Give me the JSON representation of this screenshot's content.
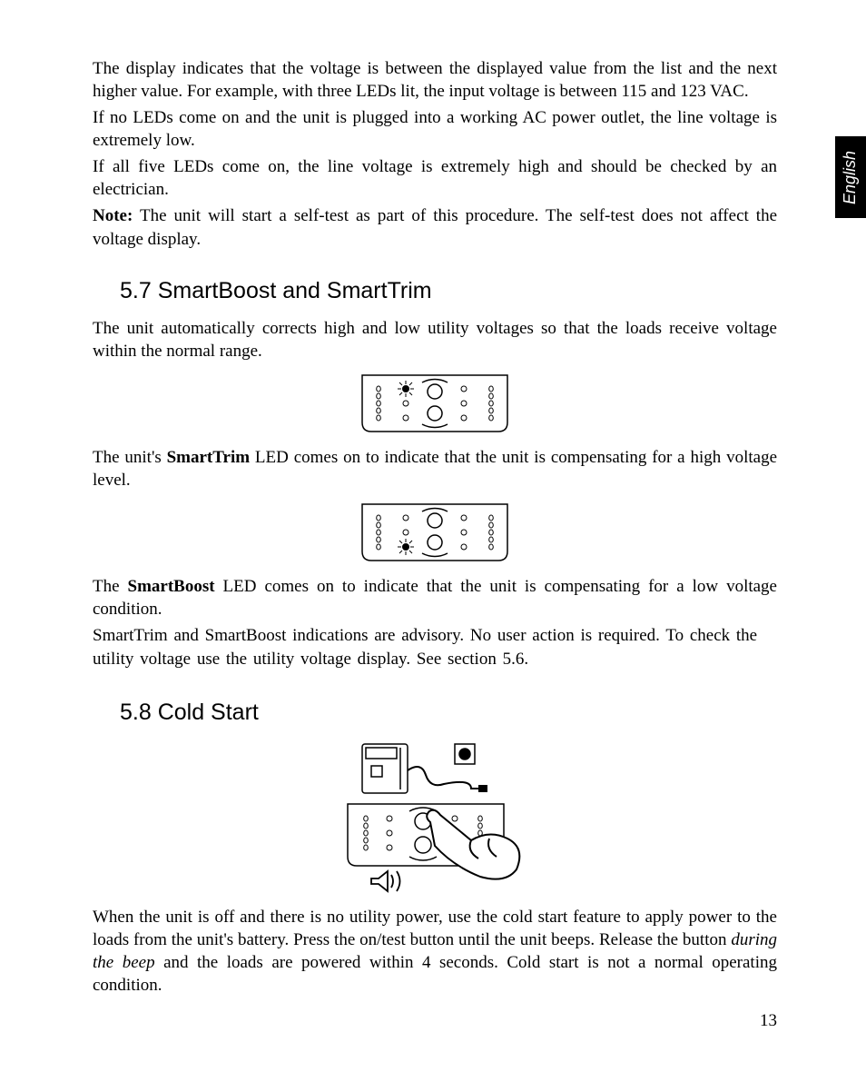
{
  "language_tab": "English",
  "p1": "The display indicates that the voltage is between the displayed value from the list and the next higher value. For example, with three LEDs lit, the input voltage is between 115 and 123 VAC.",
  "p2": "If no LEDs come on and the unit is plugged into a working AC power outlet, the line voltage is extremely low.",
  "p3": "If all five LEDs come on, the line voltage is extremely high and should be checked by an electrician.",
  "p4_label": "Note:",
  "p4": " The unit will start a self-test as part of this procedure. The self-test does not affect the voltage display.",
  "h57": "5.7 SmartBoost and SmartTrim",
  "p5": "The unit automatically corrects high and low utility voltages so that the loads receive voltage within the normal range.",
  "p6a": "The unit's ",
  "p6b": "SmartTrim",
  "p6c": " LED comes on to indicate that the unit is compensating for a high voltage level.",
  "p7a": "The ",
  "p7b": "SmartBoost",
  "p7c": " LED comes on to indicate that the unit is compensating for a low voltage condition.",
  "p8": "SmartTrim and SmartBoost indications are advisory. No user action is required. To check the utility voltage use the utility voltage display. See section 5.6.",
  "h58": "5.8 Cold Start",
  "p9a": "When the unit is off and there is no utility power, use the cold start feature to apply power to the loads from the unit's battery. Press the on/test button until the unit beeps. Release the button ",
  "p9b": "during the beep",
  "p9c": " and the loads are powered within 4 seconds. Cold start is not a normal operating condition.",
  "page_number": "13"
}
